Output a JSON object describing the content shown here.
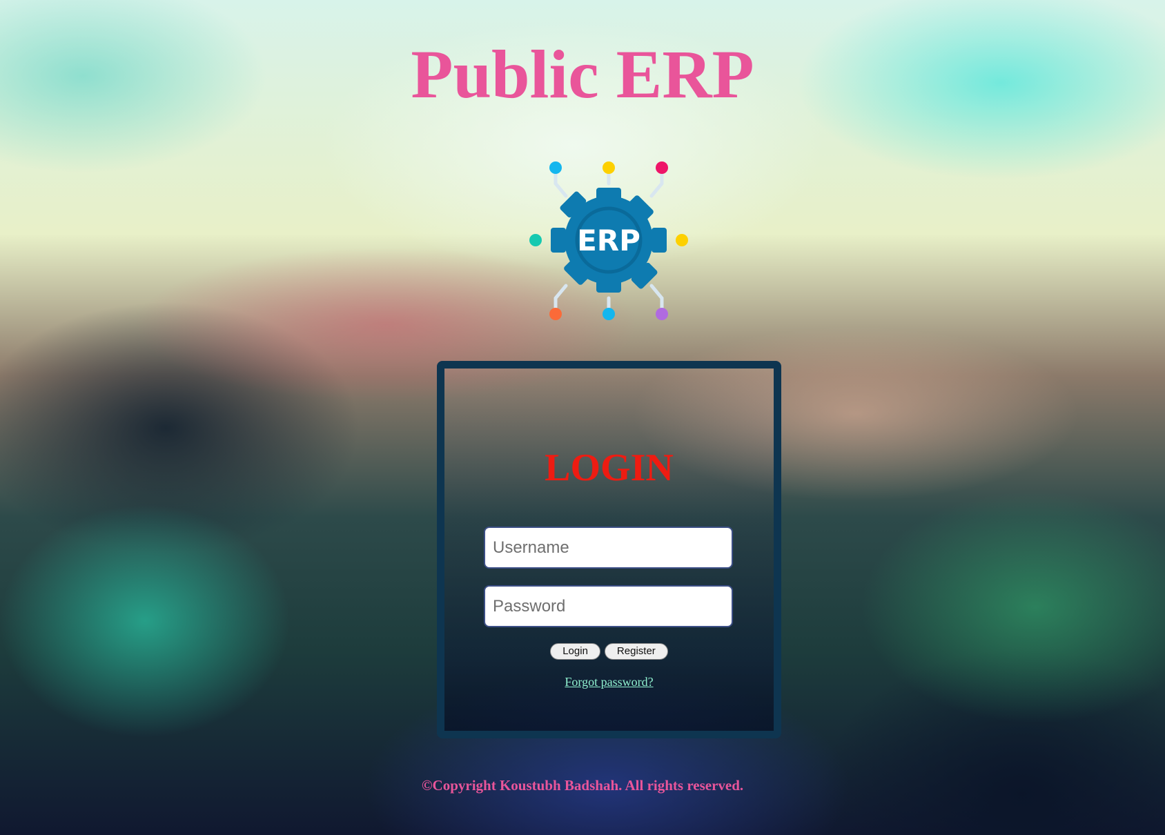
{
  "header": {
    "title": "Public ERP"
  },
  "logo": {
    "icon": "erp-gear-icon",
    "text": "ERP",
    "colors": {
      "gear": "#0e7bb0",
      "dot_blue": "#14b6ee",
      "dot_yellow": "#fdd000",
      "dot_pink": "#ee1568",
      "dot_teal": "#16c9b0",
      "dot_orange": "#fb6a38",
      "dot_purple": "#b06ae0"
    }
  },
  "login": {
    "title": "LOGIN",
    "username_placeholder": "Username",
    "username_value": "",
    "password_placeholder": "Password",
    "password_value": "",
    "login_button": "Login",
    "register_button": "Register",
    "forgot_link": "Forgot password?"
  },
  "footer": {
    "copyright": "©Copyright Koustubh Badshah. All rights reserved."
  },
  "colors": {
    "title": "#e9559a",
    "login_title": "#ee1c12",
    "card_border": "#0e3550",
    "forgot_link": "#8ff0cf"
  }
}
